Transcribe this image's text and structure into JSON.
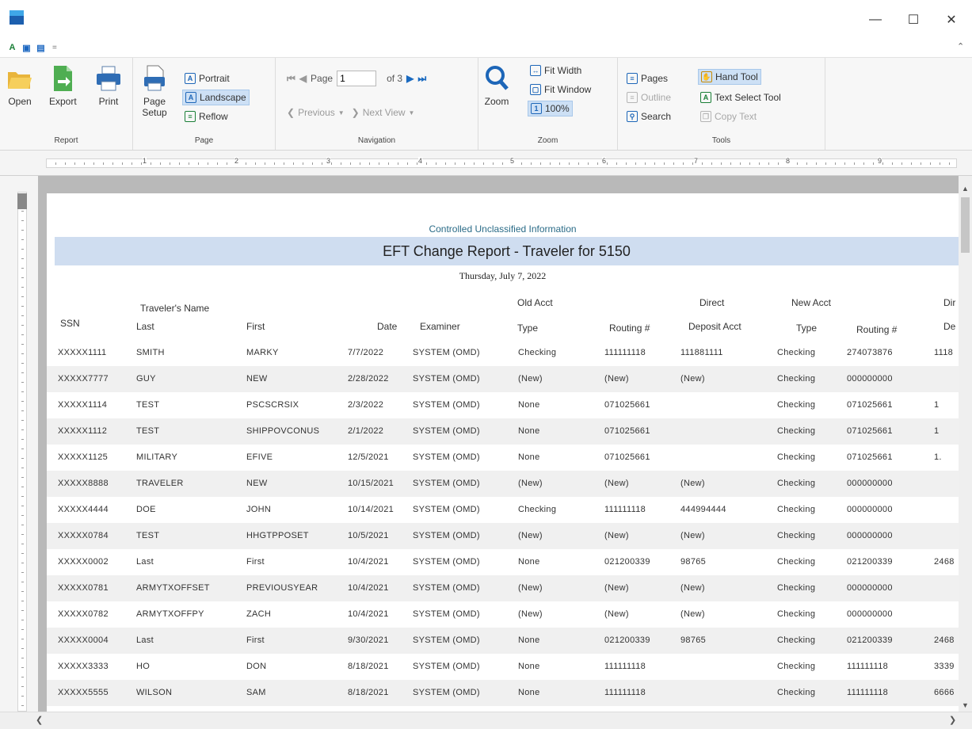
{
  "window": {
    "minimize": "—",
    "maximize": "☐",
    "close": "✕"
  },
  "qat": {
    "dropdown": "="
  },
  "ribbon": {
    "report": {
      "label": "Report",
      "open": "Open",
      "export": "Export",
      "print": "Print"
    },
    "page": {
      "label": "Page",
      "setup_line1": "Page",
      "setup_line2": "Setup",
      "portrait": "Portrait",
      "landscape": "Landscape",
      "reflow": "Reflow"
    },
    "navigation": {
      "label": "Navigation",
      "page_label": "Page",
      "page_value": "1",
      "of_pages": "of 3",
      "previous": "Previous",
      "next": "Next View"
    },
    "zoom": {
      "label": "Zoom",
      "zoom": "Zoom",
      "fit_width": "Fit Width",
      "fit_window": "Fit Window",
      "percent": "100%"
    },
    "tools": {
      "label": "Tools",
      "pages": "Pages",
      "outline": "Outline",
      "search": "Search",
      "hand_tool": "Hand Tool",
      "text_select": "Text Select Tool",
      "copy_text": "Copy Text"
    }
  },
  "ruler": {
    "numbers": [
      "1",
      "2",
      "3",
      "4",
      "5",
      "6",
      "7",
      "8",
      "9"
    ]
  },
  "report": {
    "cui": "Controlled Unclassified Information",
    "title": "EFT Change Report - Traveler for 5150",
    "date": "Thursday, July 7, 2022",
    "headers": {
      "travelers_name": "Traveler's Name",
      "old_acct": "Old Acct",
      "direct": "Direct",
      "new_acct": "New Acct",
      "dir": "Dir",
      "ssn": "SSN",
      "last": "Last",
      "first": "First",
      "date": "Date",
      "examiner": "Examiner",
      "type": "Type",
      "routing": "Routing #",
      "deposit_acct": "Deposit Acct",
      "new_type": "Type",
      "new_routing": "Routing #",
      "de": "De"
    },
    "rows": [
      [
        "XXXXX1111",
        "SMITH",
        "MARKY",
        "7/7/2022",
        "SYSTEM (OMD)",
        "Checking",
        "111111118",
        "111881111",
        "Checking",
        "274073876",
        "1118"
      ],
      [
        "XXXXX7777",
        "GUY",
        "NEW",
        "2/28/2022",
        "SYSTEM (OMD)",
        "(New)",
        "(New)",
        "(New)",
        "Checking",
        "000000000",
        ""
      ],
      [
        "XXXXX1114",
        "TEST",
        "PSCSCRSIX",
        "2/3/2022",
        "SYSTEM (OMD)",
        "None",
        "071025661",
        "",
        "Checking",
        "071025661",
        "1"
      ],
      [
        "XXXXX1112",
        "TEST",
        "SHIPPOVCONUS",
        "2/1/2022",
        "SYSTEM (OMD)",
        "None",
        "071025661",
        "",
        "Checking",
        "071025661",
        "1"
      ],
      [
        "XXXXX1125",
        "MILITARY",
        "EFIVE",
        "12/5/2021",
        "SYSTEM (OMD)",
        "None",
        "071025661",
        "",
        "Checking",
        "071025661",
        "1."
      ],
      [
        "XXXXX8888",
        "TRAVELER",
        "NEW",
        "10/15/2021",
        "SYSTEM (OMD)",
        "(New)",
        "(New)",
        "(New)",
        "Checking",
        "000000000",
        ""
      ],
      [
        "XXXXX4444",
        "DOE",
        "JOHN",
        "10/14/2021",
        "SYSTEM (OMD)",
        "Checking",
        "111111118",
        "444994444",
        "Checking",
        "000000000",
        ""
      ],
      [
        "XXXXX0784",
        "TEST",
        "HHGTPPOSET",
        "10/5/2021",
        "SYSTEM (OMD)",
        "(New)",
        "(New)",
        "(New)",
        "Checking",
        "000000000",
        ""
      ],
      [
        "XXXXX0002",
        "Last",
        "First",
        "10/4/2021",
        "SYSTEM (OMD)",
        "None",
        "021200339",
        "98765",
        "Checking",
        "021200339",
        "2468"
      ],
      [
        "XXXXX0781",
        "ARMYTXOFFSET",
        "PREVIOUSYEAR",
        "10/4/2021",
        "SYSTEM (OMD)",
        "(New)",
        "(New)",
        "(New)",
        "Checking",
        "000000000",
        ""
      ],
      [
        "XXXXX0782",
        "ARMYTXOFFPY",
        "ZACH",
        "10/4/2021",
        "SYSTEM (OMD)",
        "(New)",
        "(New)",
        "(New)",
        "Checking",
        "000000000",
        ""
      ],
      [
        "XXXXX0004",
        "Last",
        "First",
        "9/30/2021",
        "SYSTEM (OMD)",
        "None",
        "021200339",
        "98765",
        "Checking",
        "021200339",
        "2468"
      ],
      [
        "XXXXX3333",
        "HO",
        "DON",
        "8/18/2021",
        "SYSTEM (OMD)",
        "None",
        "111111118",
        "",
        "Checking",
        "111111118",
        "3339"
      ],
      [
        "XXXXX5555",
        "WILSON",
        "SAM",
        "8/18/2021",
        "SYSTEM (OMD)",
        "None",
        "111111118",
        "",
        "Checking",
        "111111118",
        "6666"
      ]
    ]
  }
}
